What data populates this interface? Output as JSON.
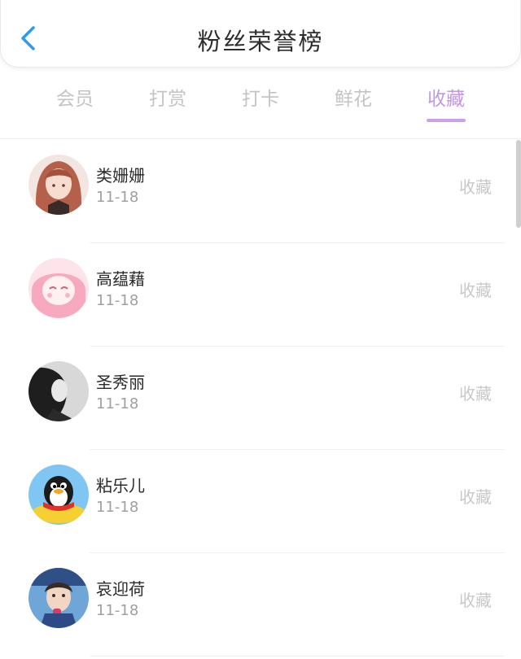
{
  "header": {
    "title": "粉丝荣誉榜",
    "back_icon": "chevron-left-icon"
  },
  "colors": {
    "accent": "#c397e4",
    "back_icon": "#2f9bea",
    "inactive_tab": "#c4c4c4"
  },
  "tabs": [
    {
      "label": "会员",
      "active": false
    },
    {
      "label": "打赏",
      "active": false
    },
    {
      "label": "打卡",
      "active": false
    },
    {
      "label": "鲜花",
      "active": false
    },
    {
      "label": "收藏",
      "active": true
    }
  ],
  "fans": [
    {
      "name": "类姗姗",
      "date": "11-18",
      "action": "收藏",
      "avatar": "anime-girl-avatar"
    },
    {
      "name": "高蕴藉",
      "date": "11-18",
      "action": "收藏",
      "avatar": "pink-anime-avatar"
    },
    {
      "name": "圣秀丽",
      "date": "11-18",
      "action": "收藏",
      "avatar": "bw-photo-avatar"
    },
    {
      "name": "粘乐儿",
      "date": "11-18",
      "action": "收藏",
      "avatar": "penguin-avatar"
    },
    {
      "name": "哀迎荷",
      "date": "11-18",
      "action": "收藏",
      "avatar": "child-photo-avatar"
    }
  ]
}
